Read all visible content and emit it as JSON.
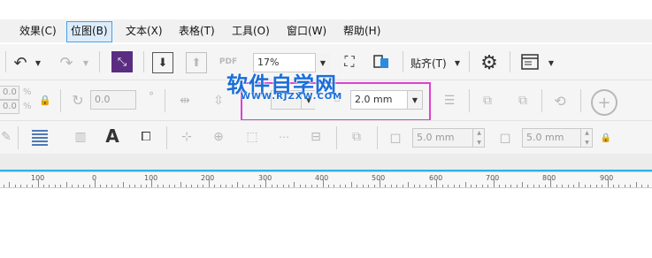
{
  "menu": {
    "items": [
      {
        "label": "效果(C)"
      },
      {
        "label": "位图(B)"
      },
      {
        "label": "文本(X)"
      },
      {
        "label": "表格(T)"
      },
      {
        "label": "工具(O)"
      },
      {
        "label": "窗口(W)"
      },
      {
        "label": "帮助(H)"
      }
    ],
    "active_index": 1
  },
  "standard_toolbar": {
    "zoom_value": "17%",
    "snap_label": "贴齐(T)",
    "pdf_label": "PDF"
  },
  "property_bar": {
    "size_top": "0.0",
    "size_bottom": "0.0",
    "percent_symbol": "%",
    "rotation_value": "0.0",
    "degree_symbol": "°",
    "outline_width": "2.0 mm"
  },
  "row3": {
    "offset_x": "5.0 mm",
    "offset_y": "5.0 mm"
  },
  "watermark": {
    "text": "软件自学网",
    "sub": "WWW.RJZXW.COM"
  },
  "ruler": {
    "labels": [
      "100",
      "0",
      "100",
      "200",
      "300",
      "400",
      "500",
      "600",
      "700",
      "800",
      "900"
    ]
  },
  "colors": {
    "highlight_border": "#e040d0",
    "watermark_blue": "#1a6fd8",
    "ruler_cyan": "#29b6e8",
    "menu_active": "#4aa0e6"
  }
}
